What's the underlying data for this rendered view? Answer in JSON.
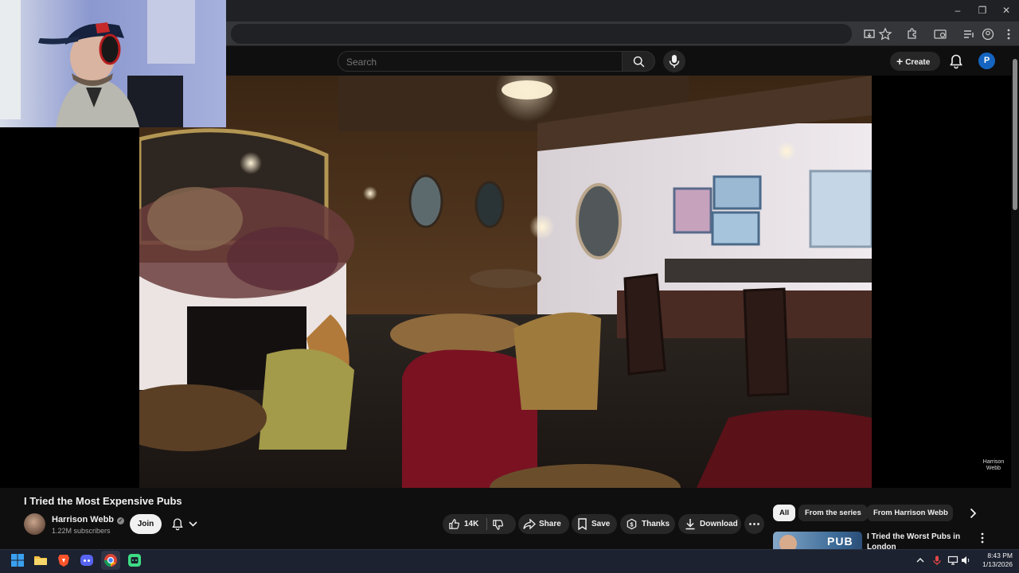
{
  "browser": {
    "window_controls": {
      "minimize": "–",
      "restore": "❐",
      "close": "✕"
    }
  },
  "youtube": {
    "search": {
      "placeholder": "Search"
    },
    "create_label": "Create",
    "profile_initial": "P"
  },
  "video": {
    "title": "I Tried the Most Expensive Pubs",
    "watermark_line1": "Harrison",
    "watermark_line2": "Webb"
  },
  "channel": {
    "name": "Harrison Webb",
    "subscribers": "1.22M subscribers",
    "join_label": "Join"
  },
  "actions": {
    "likes": "14K",
    "share": "Share",
    "save": "Save",
    "thanks": "Thanks",
    "download": "Download"
  },
  "sidebar": {
    "chips": [
      "All",
      "From the series",
      "From Harrison Webb"
    ],
    "active_chip": "All",
    "recommendation": {
      "title": "I Tried the Worst Pubs in London",
      "thumbnail_text": "PUB"
    }
  },
  "taskbar": {
    "time": "8:43 PM",
    "date": "1/13/2026",
    "apps": [
      "windows-start",
      "file-explorer",
      "brave-browser",
      "discord",
      "chrome",
      "android-studio"
    ]
  },
  "colors": {
    "accent_blue": "#1565c0",
    "background": "#0f0f0f",
    "pill": "#272727"
  }
}
